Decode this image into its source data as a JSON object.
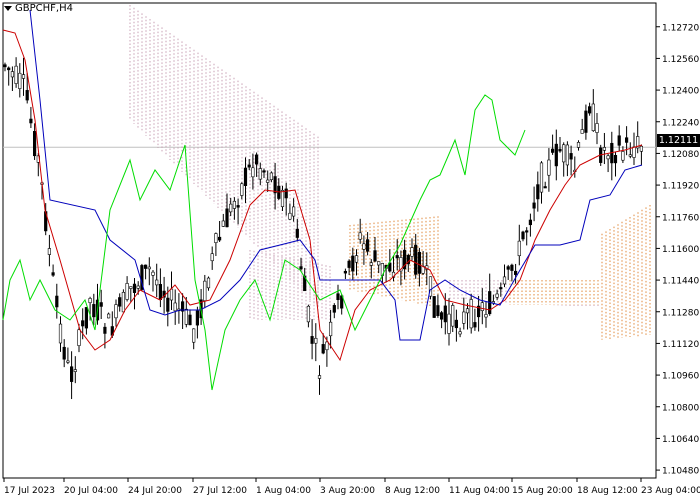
{
  "window": {
    "symbol_title": "GBPCHF,H4",
    "menu_icon": "triangle-down-icon"
  },
  "current_price": "1.12111",
  "chart_data": {
    "type": "candlestick",
    "ylim": [
      1.1044,
      1.1284
    ],
    "y_ticks": [
      "1.12720",
      "1.12560",
      "1.12400",
      "1.12240",
      "1.12080",
      "1.11920",
      "1.11760",
      "1.11600",
      "1.11440",
      "1.11280",
      "1.11120",
      "1.10960",
      "1.10800",
      "1.10640",
      "1.10480"
    ],
    "x_ticks": [
      "17 Jul 2023",
      "20 Jul 04:00",
      "24 Jul 20:00",
      "27 Jul 12:00",
      "1 Aug 04:00",
      "3 Aug 20:00",
      "8 Aug 12:00",
      "11 Aug 04:00",
      "15 Aug 20:00",
      "18 Aug 12:00",
      "23 Aug 04:00"
    ],
    "indicators": [
      "Tenkan-sen",
      "Kijun-sen",
      "Chikou Span",
      "Senkou Span A",
      "Senkou Span B"
    ],
    "colors": {
      "bull": "#000000",
      "bear": "#000000",
      "tenkan": "#cc0000",
      "kijun": "#0000bb",
      "chikou": "#00dd00",
      "cloud_bear": "#c8a0b4",
      "cloud_bull": "#e08a3c",
      "grid": "#c8c8c8",
      "current_line": "#c0c0c0"
    }
  }
}
